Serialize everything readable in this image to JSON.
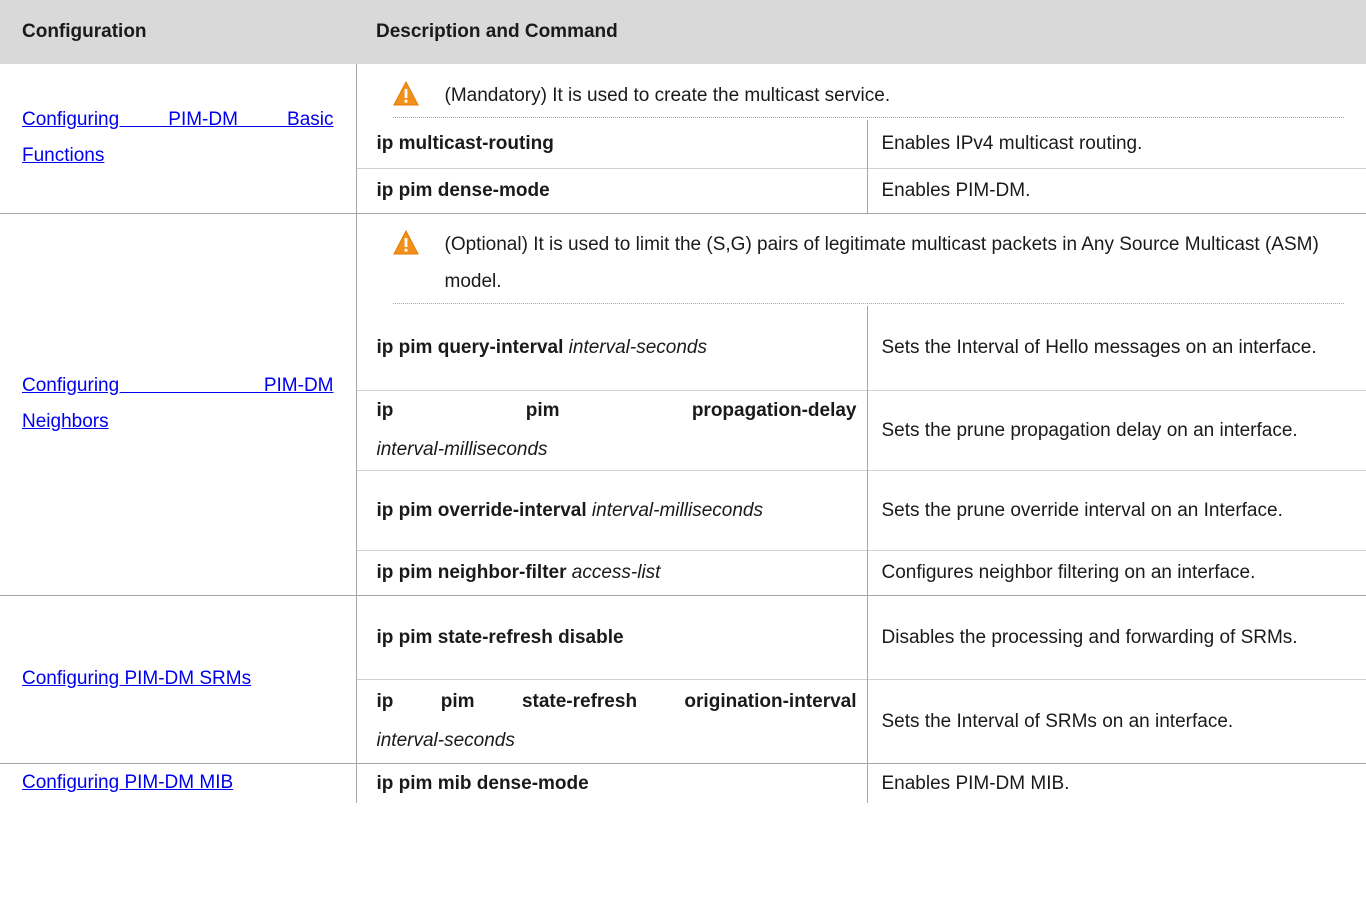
{
  "header": {
    "col1": "Configuration",
    "col2": "Description and Command"
  },
  "groups": [
    {
      "link_line1": "Configuring PIM-DM Basic",
      "link_line2": "Functions",
      "note": "(Mandatory) It is used to create the multicast service.",
      "rows": [
        {
          "cmd": "ip multicast-routing",
          "arg": "",
          "desc": "Enables IPv4 multicast routing."
        },
        {
          "cmd": "ip pim dense-mode",
          "arg": "",
          "desc": "Enables PIM-DM."
        }
      ]
    },
    {
      "link_line1": "Configuring PIM-DM",
      "link_line2": "Neighbors",
      "note": "(Optional) It is used to limit the (S,G) pairs of legitimate multicast packets in Any Source Multicast (ASM) model.",
      "rows": [
        {
          "cmd": "ip pim query-interval",
          "arg": "interval-seconds",
          "desc": "Sets the Interval of Hello messages on an interface."
        },
        {
          "cmd": "ip pim propagation-delay",
          "arg": "interval-milliseconds",
          "desc": "Sets the prune propagation delay on an interface."
        },
        {
          "cmd": "ip pim override-interval",
          "arg": "interval-milliseconds",
          "desc": "Sets the prune override interval on an Interface."
        },
        {
          "cmd": "ip pim neighbor-filter",
          "arg": "access-list",
          "desc": "Configures neighbor filtering on an interface."
        }
      ]
    },
    {
      "link_line1": "Configuring PIM-DM SRMs",
      "link_line2": "",
      "rows": [
        {
          "cmd": "ip pim state-refresh disable",
          "arg": "",
          "desc": "Disables the processing and forwarding of SRMs."
        },
        {
          "cmd": "ip pim state-refresh origination-interval",
          "arg": "interval-seconds",
          "desc": "Sets the Interval of SRMs on an interface."
        }
      ]
    },
    {
      "link_line1": "Configuring PIM-DM MIB",
      "link_line2": "",
      "rows": [
        {
          "cmd": "ip pim mib dense-mode",
          "arg": "",
          "desc": "Enables PIM-DM MIB."
        }
      ]
    }
  ],
  "icons": {
    "warning": "warning-icon"
  },
  "colors": {
    "header_bg": "#d9d9d9",
    "link": "#0000ee",
    "warning_orange": "#f39019"
  }
}
